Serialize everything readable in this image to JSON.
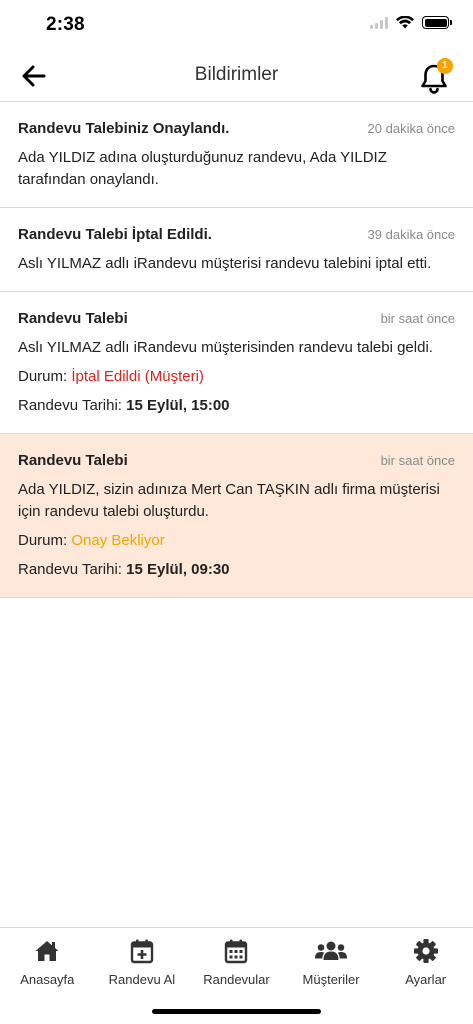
{
  "status_bar": {
    "time": "2:38"
  },
  "header": {
    "title": "Bildirimler",
    "badge_count": "1"
  },
  "notifications": [
    {
      "title": "Randevu Talebiniz Onaylandı.",
      "time": "20 dakika önce",
      "body": "Ada YILDIZ adına oluşturduğunuz randevu, Ada YILDIZ tarafından onaylandı."
    },
    {
      "title": "Randevu Talebi İptal Edildi.",
      "time": "39 dakika önce",
      "body": "Aslı YILMAZ adlı iRandevu müşterisi randevu talebini iptal etti."
    },
    {
      "title": "Randevu Talebi",
      "time": "bir saat önce",
      "body": "Aslı YILMAZ adlı iRandevu müşterisinden randevu talebi geldi.",
      "status_label": "Durum:",
      "status_value": "İptal Edildi (Müşteri)",
      "date_label": "Randevu Tarihi:",
      "date_value": "15 Eylül, 15:00"
    },
    {
      "title": "Randevu Talebi",
      "time": "bir saat önce",
      "body": "Ada YILDIZ, sizin adınıza Mert Can TAŞKIN  adlı firma müşterisi için randevu talebi oluşturdu.",
      "status_label": "Durum:",
      "status_value": "Onay Bekliyor",
      "date_label": "Randevu Tarihi:",
      "date_value": "15 Eylül, 09:30"
    }
  ],
  "tabs": [
    {
      "label": "Anasayfa",
      "icon": "home-icon"
    },
    {
      "label": "Randevu Al",
      "icon": "calendar-plus-icon"
    },
    {
      "label": "Randevular",
      "icon": "calendar-icon"
    },
    {
      "label": "Müşteriler",
      "icon": "users-icon"
    },
    {
      "label": "Ayarlar",
      "icon": "gear-icon"
    }
  ],
  "colors": {
    "highlight_bg": "#fde8d9",
    "status_cancelled": "#e0201b",
    "status_pending": "#f0a500",
    "badge": "#f5a300"
  }
}
